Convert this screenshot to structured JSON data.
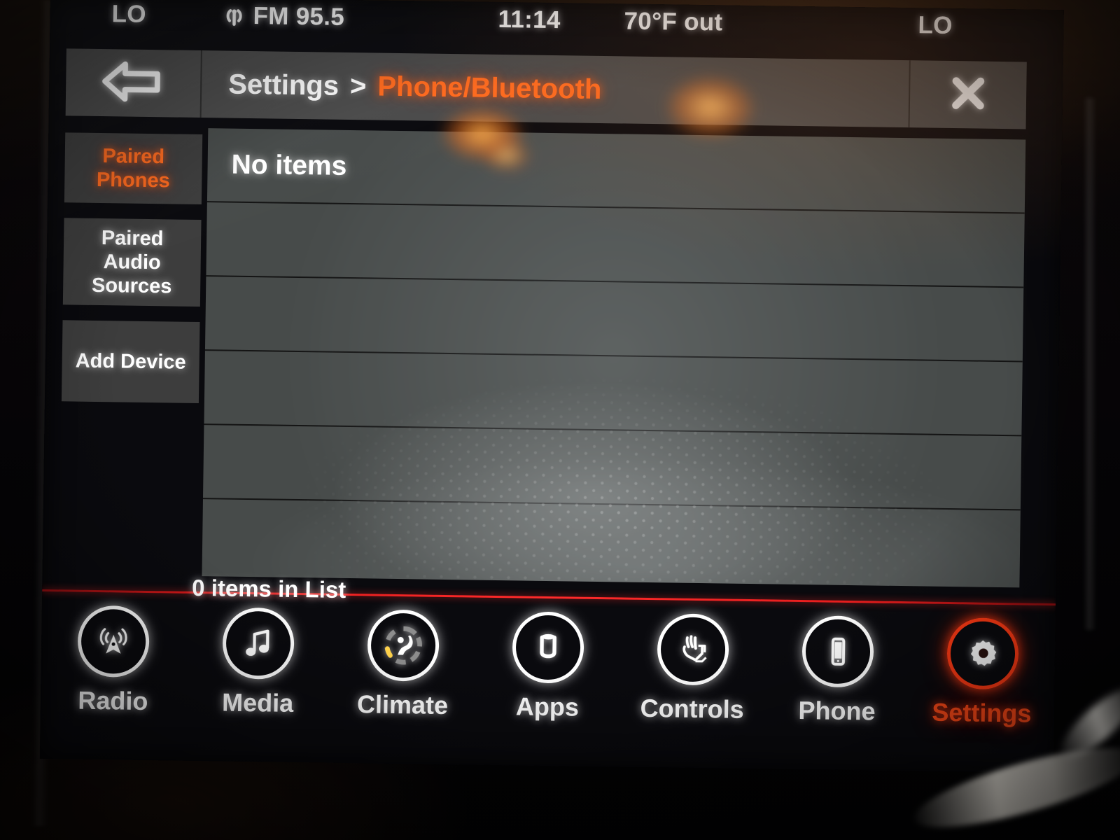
{
  "status_bar": {
    "left_temp": "LO",
    "radio_icon": "antenna-broadcast-icon",
    "radio_station": "FM 95.5",
    "clock": "11:14",
    "outside_temp": "70°F out",
    "right_temp": "LO"
  },
  "header": {
    "back_icon": "back-arrow-icon",
    "breadcrumb_root": "Settings",
    "breadcrumb_separator": ">",
    "breadcrumb_current": "Phone/Bluetooth",
    "close_icon": "close-x-icon",
    "accent_color": "#ff6a1e"
  },
  "sidebar": {
    "tabs": [
      {
        "label": "Paired\nPhones",
        "line1": "Paired",
        "line2": "Phones",
        "active": true
      },
      {
        "label": "Paired Audio Sources",
        "line1": "Paired",
        "line2": "Audio",
        "line3": "Sources",
        "active": false
      },
      {
        "label": "Add Device",
        "line1": "Add Device",
        "active": false
      }
    ]
  },
  "list": {
    "rows": [
      {
        "text": "No items"
      },
      {
        "text": ""
      },
      {
        "text": ""
      },
      {
        "text": ""
      },
      {
        "text": ""
      },
      {
        "text": ""
      }
    ],
    "status_line": "0 items in List",
    "divider_color": "#ff2b2b"
  },
  "navbar": {
    "items": [
      {
        "label": "Radio",
        "icon": "radio-tower-icon",
        "active": false
      },
      {
        "label": "Media",
        "icon": "music-note-icon",
        "active": false
      },
      {
        "label": "Climate",
        "icon": "climate-dial-icon",
        "active": false
      },
      {
        "label": "Apps",
        "icon": "uconnect-u-icon",
        "active": false
      },
      {
        "label": "Controls",
        "icon": "hand-controls-icon",
        "active": false
      },
      {
        "label": "Phone",
        "icon": "smartphone-icon",
        "active": false
      },
      {
        "label": "Settings",
        "icon": "gear-icon",
        "active": true
      }
    ],
    "active_color": "#ff4a18"
  }
}
